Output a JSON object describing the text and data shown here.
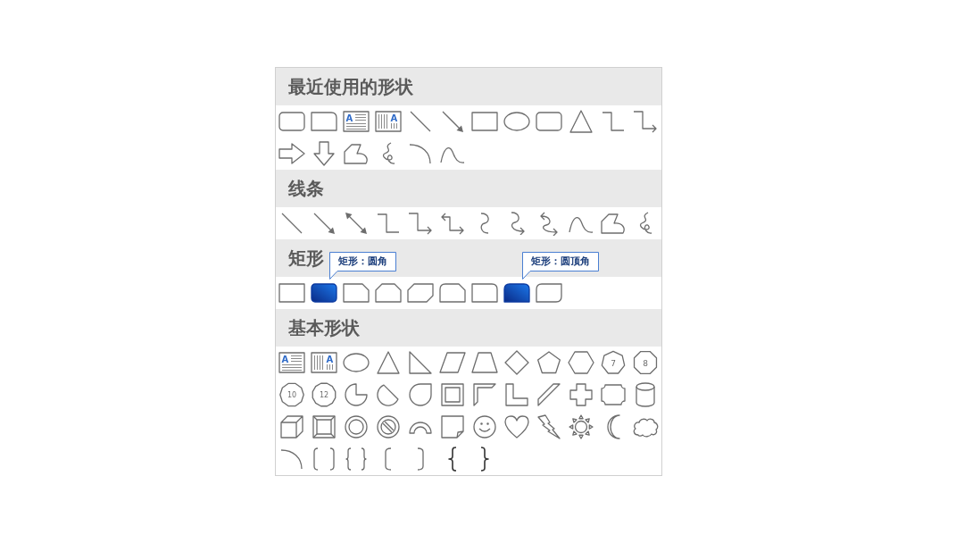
{
  "panel": {
    "sections": [
      {
        "title": "最近使用的形状",
        "shapes": [
          {
            "kind": "roundrect"
          },
          {
            "kind": "round1"
          },
          {
            "kind": "textbox",
            "label": "A"
          },
          {
            "kind": "vtextbox",
            "label": "A"
          },
          {
            "kind": "line"
          },
          {
            "kind": "arrowline"
          },
          {
            "kind": "rect"
          },
          {
            "kind": "oval"
          },
          {
            "kind": "roundrect"
          },
          {
            "kind": "triangle"
          },
          {
            "kind": "elbow"
          },
          {
            "kind": "elbowarrow"
          },
          {
            "kind": "rightarrow"
          },
          {
            "kind": "downarrow"
          },
          {
            "kind": "freeform"
          },
          {
            "kind": "scribble"
          },
          {
            "kind": "arc"
          },
          {
            "kind": "curve"
          }
        ]
      },
      {
        "title": "线条",
        "shapes": [
          {
            "kind": "line"
          },
          {
            "kind": "arrowline"
          },
          {
            "kind": "doublearrowline"
          },
          {
            "kind": "elbow"
          },
          {
            "kind": "elbowarrow"
          },
          {
            "kind": "elbowdoublearrow"
          },
          {
            "kind": "curvedconnector"
          },
          {
            "kind": "curvedarrow"
          },
          {
            "kind": "curveddoublearrow"
          },
          {
            "kind": "curve"
          },
          {
            "kind": "freeform"
          },
          {
            "kind": "scribble"
          }
        ]
      },
      {
        "title": "矩形",
        "shapes": [
          {
            "kind": "rect",
            "highlighted": false
          },
          {
            "kind": "roundrect",
            "highlighted": true,
            "tooltip": "矩形：圆角"
          },
          {
            "kind": "snip1",
            "highlighted": false
          },
          {
            "kind": "snipsame",
            "highlighted": false
          },
          {
            "kind": "snipdiag",
            "highlighted": false
          },
          {
            "kind": "snipround",
            "highlighted": false
          },
          {
            "kind": "round1",
            "highlighted": false
          },
          {
            "kind": "roundsame",
            "highlighted": true,
            "tooltip": "矩形：圆顶角"
          },
          {
            "kind": "rounddiag",
            "highlighted": false
          }
        ]
      },
      {
        "title": "基本形状",
        "shapes": [
          {
            "kind": "textbox",
            "label": "A"
          },
          {
            "kind": "vtextbox",
            "label": "A"
          },
          {
            "kind": "oval"
          },
          {
            "kind": "triangle"
          },
          {
            "kind": "righttriangle"
          },
          {
            "kind": "parallelogram"
          },
          {
            "kind": "trapezoid"
          },
          {
            "kind": "diamond"
          },
          {
            "kind": "pentagon"
          },
          {
            "kind": "hexagon"
          },
          {
            "kind": "heptagon",
            "label": "7"
          },
          {
            "kind": "octagon",
            "label": "8"
          },
          {
            "kind": "decagon",
            "label": "10"
          },
          {
            "kind": "dodecagon",
            "label": "12"
          },
          {
            "kind": "pie"
          },
          {
            "kind": "chord"
          },
          {
            "kind": "teardrop"
          },
          {
            "kind": "frame"
          },
          {
            "kind": "halfframe"
          },
          {
            "kind": "lshape"
          },
          {
            "kind": "diagstripe"
          },
          {
            "kind": "cross"
          },
          {
            "kind": "plaque"
          },
          {
            "kind": "can"
          },
          {
            "kind": "cube"
          },
          {
            "kind": "bevel"
          },
          {
            "kind": "donut"
          },
          {
            "kind": "nosymbol"
          },
          {
            "kind": "blockarc"
          },
          {
            "kind": "foldedcorner"
          },
          {
            "kind": "smiley"
          },
          {
            "kind": "heart"
          },
          {
            "kind": "lightning"
          },
          {
            "kind": "sun"
          },
          {
            "kind": "moon"
          },
          {
            "kind": "cloud"
          },
          {
            "kind": "arc"
          },
          {
            "kind": "doublebracket"
          },
          {
            "kind": "doublebrace"
          },
          {
            "kind": "leftbracket"
          },
          {
            "kind": "rightbracket"
          },
          {
            "kind": "leftbrace"
          },
          {
            "kind": "rightbrace"
          }
        ]
      }
    ]
  }
}
